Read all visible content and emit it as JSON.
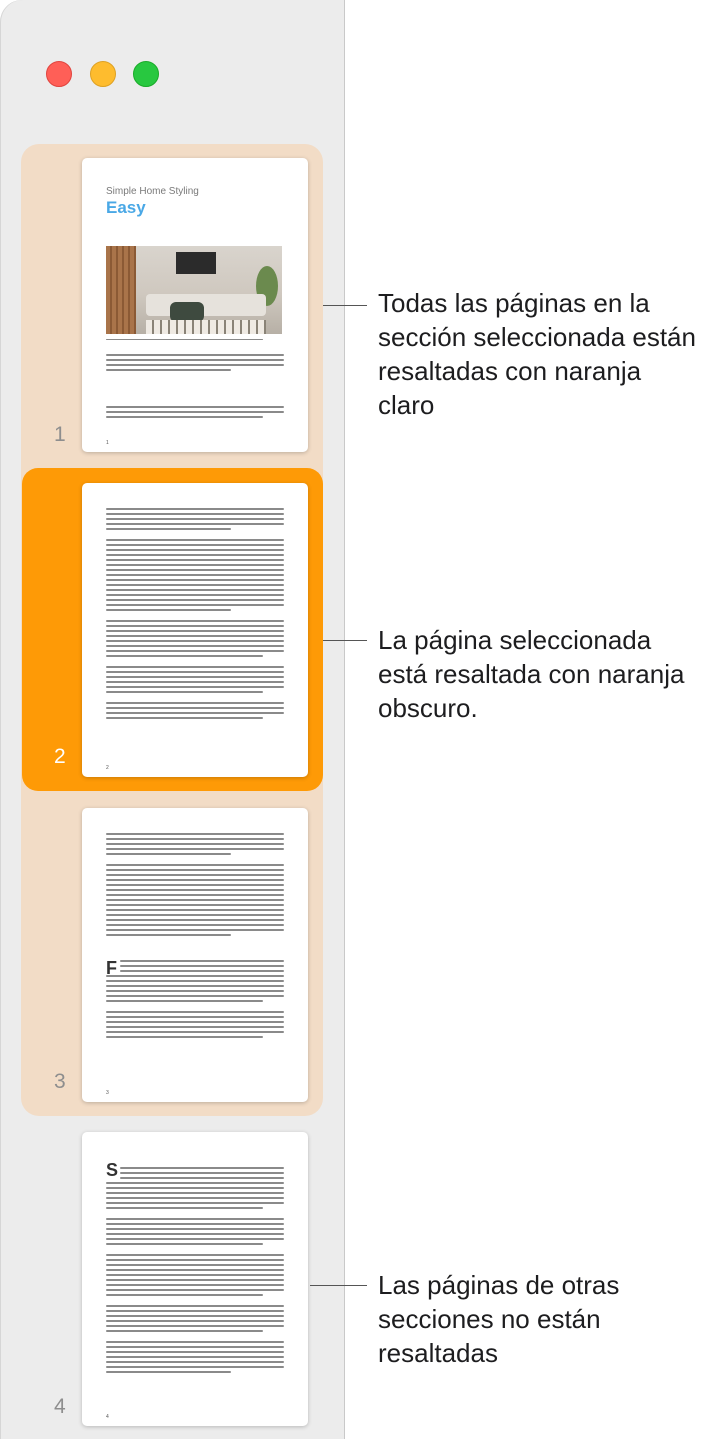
{
  "window": {
    "buttons": [
      "close",
      "minimize",
      "zoom"
    ]
  },
  "pages": [
    {
      "number": "1",
      "state": "section",
      "subtitle": "Simple Home Styling",
      "title": "Easy",
      "footer": "1"
    },
    {
      "number": "2",
      "state": "selected",
      "footer": "2"
    },
    {
      "number": "3",
      "state": "section",
      "dropcap": "F",
      "footer": "3"
    },
    {
      "number": "4",
      "state": "none",
      "dropcap": "S",
      "footer": "4"
    }
  ],
  "callouts": {
    "section": "Todas las páginas en la sección seleccionada están resaltadas con naranja claro",
    "selected": "La página seleccionada está resaltada con naranja obscuro.",
    "other": "Las páginas de otras secciones no están resaltadas"
  },
  "colors": {
    "section_highlight": "#f2dcc6",
    "page_highlight": "#fe9a06",
    "title_accent": "#4aa8e6"
  }
}
